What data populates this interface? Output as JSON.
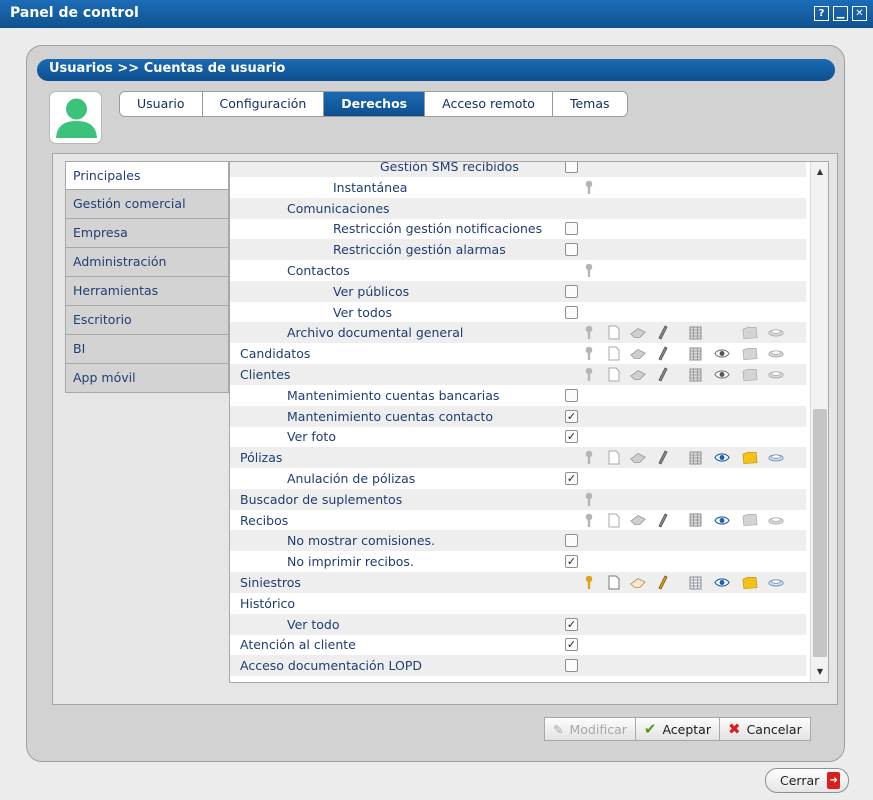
{
  "window": {
    "title": "Panel de control",
    "buttons": [
      {
        "icon": "help-icon",
        "glyph": "?"
      },
      {
        "icon": "minimize-icon",
        "glyph": "▁"
      },
      {
        "icon": "close-icon",
        "glyph": "✕"
      }
    ]
  },
  "breadcrumb": "Usuarios >> Cuentas de usuario",
  "tabs": [
    {
      "label": "Usuario",
      "active": false
    },
    {
      "label": "Configuración",
      "active": false
    },
    {
      "label": "Derechos",
      "active": true
    },
    {
      "label": "Acceso remoto",
      "active": false
    },
    {
      "label": "Temas",
      "active": false
    }
  ],
  "nav": [
    {
      "label": "Principales",
      "active": true
    },
    {
      "label": "Gestión comercial",
      "active": false
    },
    {
      "label": "Empresa",
      "active": false
    },
    {
      "label": "Administración",
      "active": false
    },
    {
      "label": "Herramientas",
      "active": false
    },
    {
      "label": "Escritorio",
      "active": false
    },
    {
      "label": "BI",
      "active": false
    },
    {
      "label": "App móvil",
      "active": false
    }
  ],
  "permissions": [
    {
      "label": "Gestión SMS recibidos",
      "level": 4,
      "checkbox": false,
      "icons": []
    },
    {
      "label": "Instantánea",
      "level": 3,
      "icons": [
        {
          "name": "key-icon",
          "on": false
        }
      ]
    },
    {
      "label": "Comunicaciones",
      "level": 2,
      "icons": []
    },
    {
      "label": "Restricción gestión notificaciones",
      "level": 3,
      "checkbox": false,
      "icons": []
    },
    {
      "label": "Restricción gestión alarmas",
      "level": 3,
      "checkbox": false,
      "icons": []
    },
    {
      "label": "Contactos",
      "level": 2,
      "icons": [
        {
          "name": "key-icon",
          "on": false
        }
      ]
    },
    {
      "label": "Ver públicos",
      "level": 3,
      "checkbox": false,
      "icons": []
    },
    {
      "label": "Ver todos",
      "level": 3,
      "checkbox": false,
      "icons": []
    },
    {
      "label": "Archivo documental general",
      "level": 2,
      "icons": [
        {
          "name": "key-icon",
          "on": false
        },
        {
          "name": "new-document-icon",
          "on": false
        },
        {
          "name": "eraser-icon",
          "on": false
        },
        {
          "name": "pencil-icon",
          "on": false
        },
        {
          "name": "grid-icon",
          "on": false
        },
        {
          "name": "folder-icon",
          "on": false
        },
        {
          "name": "export-icon",
          "on": false
        }
      ]
    },
    {
      "label": "Candidatos",
      "level": 1,
      "icons": [
        {
          "name": "key-icon",
          "on": false
        },
        {
          "name": "new-document-icon",
          "on": false
        },
        {
          "name": "eraser-icon",
          "on": false
        },
        {
          "name": "pencil-icon",
          "on": false
        },
        {
          "name": "grid-icon",
          "on": false
        },
        {
          "name": "eye-icon",
          "on": false
        },
        {
          "name": "folder-icon",
          "on": false
        },
        {
          "name": "export-icon",
          "on": false
        }
      ]
    },
    {
      "label": "Clientes",
      "level": 1,
      "icons": [
        {
          "name": "key-icon",
          "on": false
        },
        {
          "name": "new-document-icon",
          "on": false
        },
        {
          "name": "eraser-icon",
          "on": false
        },
        {
          "name": "pencil-icon",
          "on": false
        },
        {
          "name": "grid-icon",
          "on": false
        },
        {
          "name": "eye-icon",
          "on": false
        },
        {
          "name": "folder-icon",
          "on": false
        },
        {
          "name": "export-icon",
          "on": false
        }
      ]
    },
    {
      "label": "Mantenimiento cuentas bancarias",
      "level": 2,
      "checkbox": false,
      "icons": []
    },
    {
      "label": "Mantenimiento cuentas contacto",
      "level": 2,
      "checkbox": true,
      "icons": []
    },
    {
      "label": "Ver foto",
      "level": 2,
      "checkbox": true,
      "icons": []
    },
    {
      "label": "Pólizas",
      "level": 1,
      "icons": [
        {
          "name": "key-icon",
          "on": false
        },
        {
          "name": "new-document-icon",
          "on": false
        },
        {
          "name": "eraser-icon",
          "on": false
        },
        {
          "name": "pencil-icon",
          "on": false
        },
        {
          "name": "grid-icon",
          "on": false
        },
        {
          "name": "eye-icon",
          "on": true
        },
        {
          "name": "folder-icon",
          "on": true
        },
        {
          "name": "export-icon",
          "on": true
        }
      ]
    },
    {
      "label": "Anulación de pólizas",
      "level": 2,
      "checkbox": true,
      "icons": []
    },
    {
      "label": "Buscador de suplementos",
      "level": 1,
      "icons": [
        {
          "name": "key-icon",
          "on": false
        }
      ]
    },
    {
      "label": "Recibos",
      "level": 1,
      "icons": [
        {
          "name": "key-icon",
          "on": false
        },
        {
          "name": "new-document-icon",
          "on": false
        },
        {
          "name": "eraser-icon",
          "on": false
        },
        {
          "name": "pencil-icon",
          "on": false
        },
        {
          "name": "grid-icon",
          "on": false
        },
        {
          "name": "eye-icon",
          "on": true
        },
        {
          "name": "folder-icon",
          "on": false
        },
        {
          "name": "export-icon",
          "on": false
        }
      ]
    },
    {
      "label": "No mostrar comisiones.",
      "level": 2,
      "checkbox": false,
      "icons": []
    },
    {
      "label": "No imprimir recibos.",
      "level": 2,
      "checkbox": true,
      "icons": []
    },
    {
      "label": "Siniestros",
      "level": 1,
      "icons": [
        {
          "name": "key-icon",
          "on": true
        },
        {
          "name": "new-document-icon",
          "on": true
        },
        {
          "name": "eraser-icon",
          "on": true
        },
        {
          "name": "pencil-icon",
          "on": true
        },
        {
          "name": "grid-icon",
          "on": true
        },
        {
          "name": "eye-icon",
          "on": true
        },
        {
          "name": "folder-icon",
          "on": true
        },
        {
          "name": "export-icon",
          "on": true
        }
      ]
    },
    {
      "label": "Histórico",
      "level": 1,
      "icons": []
    },
    {
      "label": "Ver todo",
      "level": 2,
      "checkbox": true,
      "icons": []
    },
    {
      "label": "Atención al cliente",
      "level": 1,
      "checkbox": true,
      "icons": []
    },
    {
      "label": "Acceso documentación LOPD",
      "level": 1,
      "checkbox": false,
      "icons": []
    }
  ],
  "footer": {
    "modify_label": "Modificar",
    "accept_label": "Aceptar",
    "cancel_label": "Cancelar"
  },
  "close_label": "Cerrar",
  "colors": {
    "brand_blue": "#0d4f8f",
    "eye_blue": "#1f5fa6",
    "folder_yellow": "#f2c21b",
    "key_gold": "#e0a31c",
    "accept_green": "#4c9d1f",
    "cancel_red": "#d9201f"
  }
}
